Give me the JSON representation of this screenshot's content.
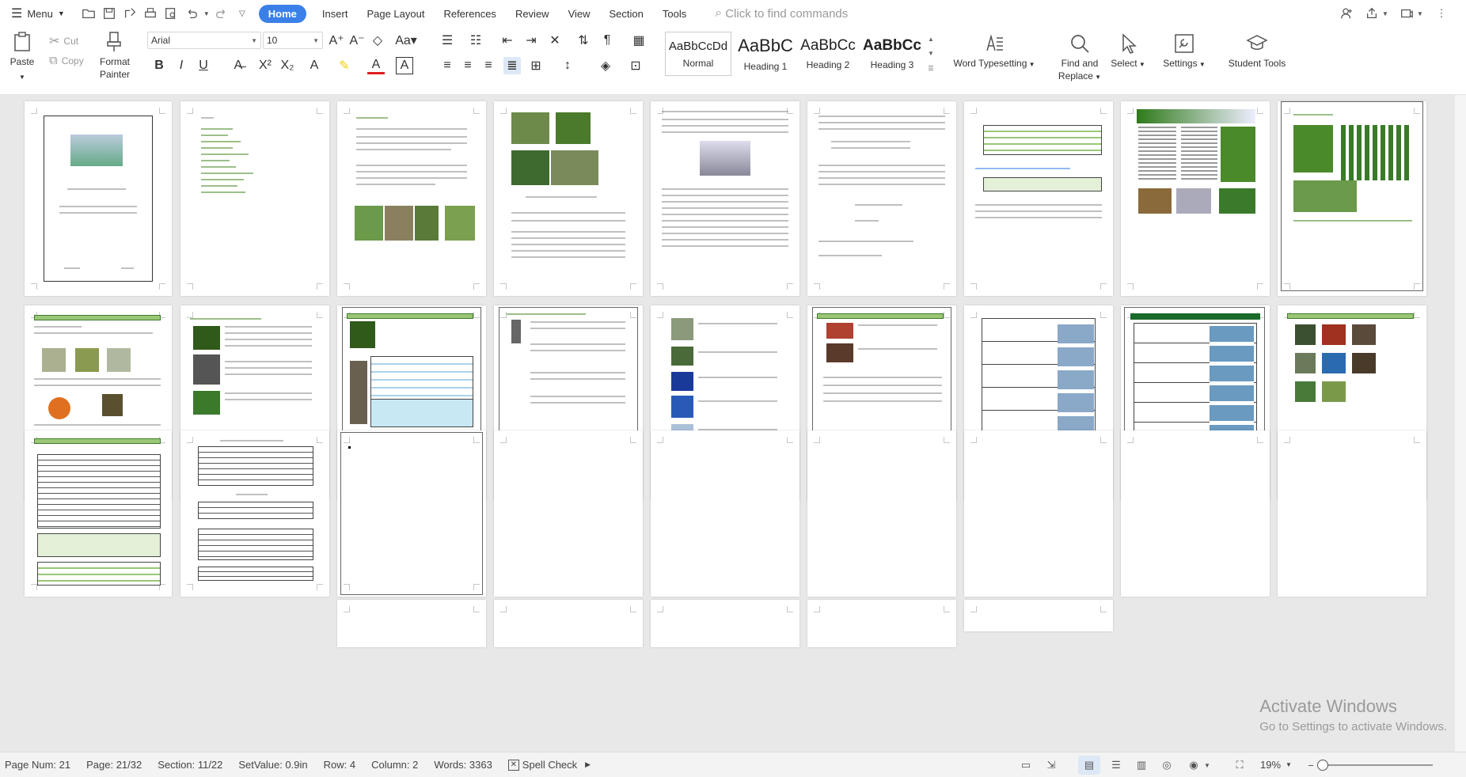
{
  "menubar": {
    "menu_label": "Menu",
    "tabs": [
      "Home",
      "Insert",
      "Page Layout",
      "References",
      "Review",
      "View",
      "Section",
      "Tools"
    ],
    "active_tab": "Home",
    "search_placeholder": "Click to find commands"
  },
  "ribbon": {
    "paste": "Paste",
    "cut": "Cut",
    "copy": "Copy",
    "format_painter_1": "Format",
    "format_painter_2": "Painter",
    "font_name": "Arial",
    "font_size": "10",
    "styles": [
      {
        "preview": "AaBbCcDd",
        "name": "Normal"
      },
      {
        "preview": "AaBbC",
        "name": "Heading 1"
      },
      {
        "preview": "AaBbCc",
        "name": "Heading 2"
      },
      {
        "preview": "AaBbCc",
        "name": "Heading 3"
      }
    ],
    "word_typesetting": "Word Typesetting",
    "find_replace_1": "Find and",
    "find_replace_2": "Replace",
    "select": "Select",
    "settings": "Settings",
    "student_tools": "Student Tools"
  },
  "watermark": {
    "title": "Activate Windows",
    "subtitle": "Go to Settings to activate Windows."
  },
  "statusbar": {
    "page_num": "Page Num: 21",
    "page": "Page: 21/32",
    "section": "Section: 11/22",
    "setvalue": "SetValue: 0.9in",
    "row": "Row: 4",
    "column": "Column: 2",
    "words": "Words: 3363",
    "spell_check": "Spell Check",
    "zoom": "19%"
  },
  "colors": {
    "accent": "#3a80e8",
    "heading_green": "#9ac775",
    "canvas_bg": "#e8e8e8"
  }
}
